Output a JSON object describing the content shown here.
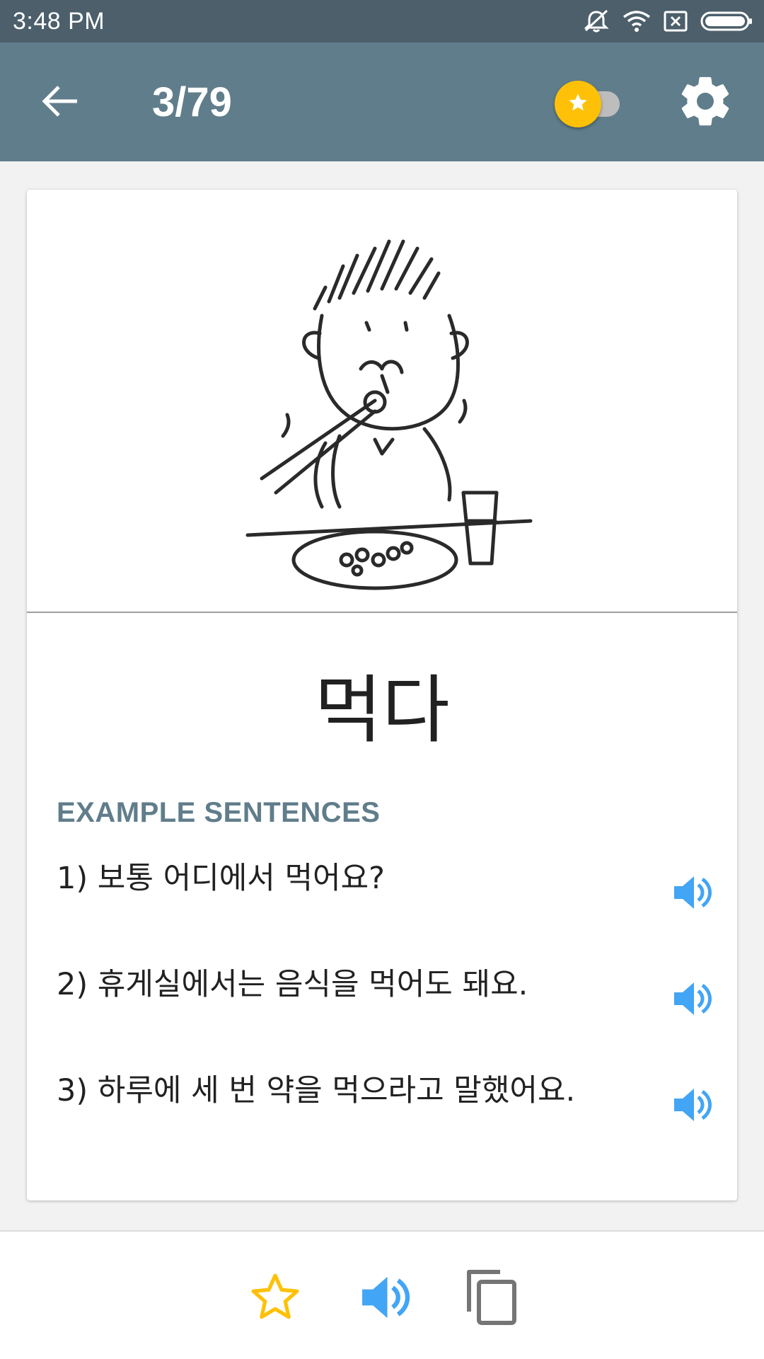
{
  "status_bar": {
    "time": "3:48 PM",
    "icons": [
      "mute-icon",
      "wifi-icon",
      "no-sim-icon",
      "battery-icon"
    ]
  },
  "app_bar": {
    "counter": "3/79",
    "icons": [
      "back-arrow-icon",
      "star-icon",
      "gear-icon"
    ],
    "favorites_toggle_on": false,
    "color": "#607d8b"
  },
  "card": {
    "word": "먹다",
    "section_title": "EXAMPLE SENTENCES",
    "sentences": [
      {
        "text": "1) 보통 어디에서 먹어요?",
        "icon": "speaker-icon"
      },
      {
        "text": "2) 휴게실에서는 음식을 먹어도 돼요.",
        "icon": "speaker-icon"
      },
      {
        "text": "3) 하루에 세 번 약을 먹으라고 말했어요.",
        "icon": "speaker-icon"
      }
    ]
  },
  "bottom_bar": {
    "icons": [
      "star-outline-icon",
      "speaker-icon",
      "copy-icon"
    ]
  },
  "colors": {
    "accent_yellow": "#ffc107",
    "audio_blue": "#42a5f5",
    "section_title": "#607d8b",
    "status_bar": "#4c5f6b"
  }
}
